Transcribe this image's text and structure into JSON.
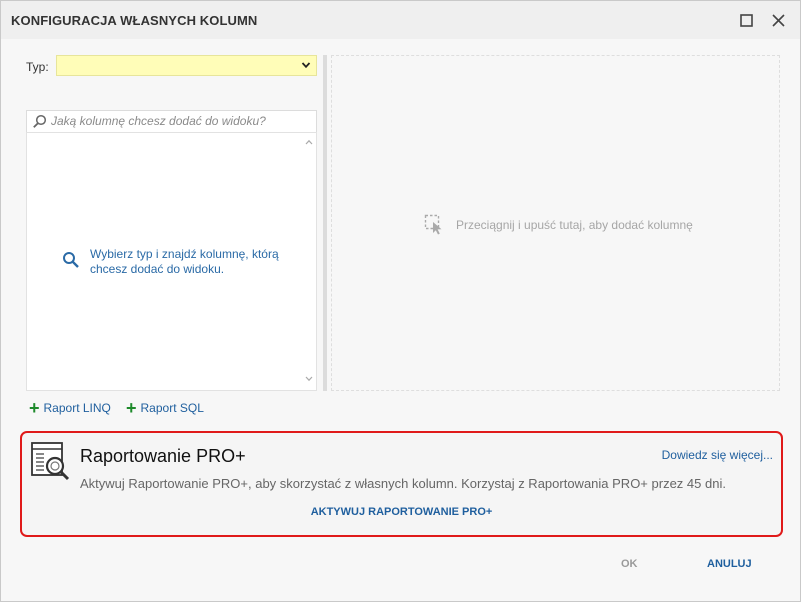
{
  "dialog": {
    "title": "KONFIGURACJA WŁASNYCH KOLUMN"
  },
  "type_field": {
    "label": "Typ:",
    "value": ""
  },
  "search": {
    "placeholder": "Jaką kolumnę chcesz dodać do widoku?"
  },
  "list": {
    "hint": "Wybierz typ i znajdź kolumnę, którą chcesz dodać do widoku."
  },
  "drop_zone": {
    "text": "Przeciągnij i upuść tutaj, aby dodać kolumnę"
  },
  "actions": {
    "linq_label": "Raport LINQ",
    "sql_label": "Raport SQL"
  },
  "promo": {
    "title": "Raportowanie PRO+",
    "more_link": "Dowiedz się więcej...",
    "description": "Aktywuj Raportowanie PRO+, aby skorzystać z własnych kolumn. Korzystaj z Raportowania PRO+ przez 45 dni.",
    "activate_label": "AKTYWUJ RAPORTOWANIE PRO+",
    "border_color": "#e01a1a"
  },
  "footer": {
    "ok_label": "OK",
    "cancel_label": "ANULUJ"
  },
  "colors": {
    "accent": "#1f5f9e",
    "add_green": "#1e8a2b",
    "select_bg": "#fffdb8"
  }
}
